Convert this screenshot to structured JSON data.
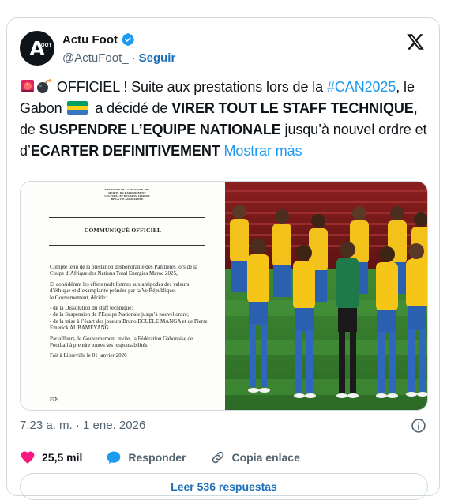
{
  "author": {
    "name": "Actu Foot",
    "handle": "@ActuFoot_",
    "separator": "·",
    "follow_label": "Seguir",
    "avatar_text_big": "A",
    "avatar_text_small": "FOOT"
  },
  "tweet": {
    "text_1": " OFFICIEL ! Suite aux prestations lors de la ",
    "hashtag": "#CAN2025",
    "text_2": ", le Gabon ",
    "text_3": " a décidé de ",
    "bold_1": "VIRER TOUT LE STAFF TECHNIQUE",
    "text_4": ", de ",
    "bold_2": "SUSPENDRE L’EQUIPE NATIONALE",
    "text_5": " jusqu’à nouvel ordre et d’",
    "bold_3": "ECARTER DEFINITIVEMENT",
    "show_more": "Mostrar más"
  },
  "document": {
    "ministry": "MINISTERE DE LA JEUNESSE, DES SPORTS, DU RAYONNEMENT CULTUREL ET DES ARTS, CHARGE DE LA VIE ASSOCIATIVE",
    "title": "COMMUNIQUÉ OFFICIEL",
    "para_1": "Compte tenu de la prestation  déshonorante des Panthères lors  de la Coupe d’Afrique des Nations Total Energies Maroc 2025,",
    "para_2": "Et considérant les effets multiformes aux antipodes des valeurs d’éthique et d’examplarité prônées par la Ve République,",
    "para_3": "le Gouvernement, décide:",
    "item_1": "- de la  Dissolution du staff technique;",
    "item_2": "- de la Suspension de l’Équipe Nationale jusqu’à nouvel ordre;",
    "item_3": "- de la mise à l’écart des joueurs Bruno ECUELE MANGA et de Pierre Emerick AUBAMEYANG.",
    "para_4": "Par ailleurs, le Gouvernement invite, la Fédération Gabonaise de Football à prendre toutes ses responsabilités.",
    "signature": "Fait à Libreville le 01 janvier 2026",
    "fin": "FIN"
  },
  "meta": {
    "time": "7:23 a. m.",
    "separator": "·",
    "date": "1 ene. 2026"
  },
  "actions": {
    "likes": "25,5 mil",
    "reply_label": "Responder",
    "copy_label": "Copia enlace"
  },
  "replies_button": "Leer 536 respuestas",
  "colors": {
    "link": "#1d9bf0",
    "like": "#f91880",
    "gabon_flag": [
      "#009e60",
      "#fcd116",
      "#3a75c4"
    ]
  },
  "icons": [
    "siren-icon",
    "bomb-icon",
    "verified-icon",
    "x-logo-icon",
    "info-icon",
    "heart-icon",
    "reply-icon",
    "link-icon"
  ]
}
